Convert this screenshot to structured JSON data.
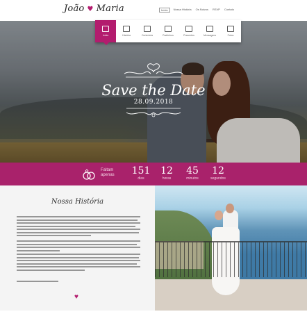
{
  "header": {
    "logo_left": "João",
    "logo_right": "Maria",
    "nav": [
      "Início",
      "Nossa História",
      "Os Noivos",
      "RSVP",
      "Contato"
    ],
    "nav_active": "Início"
  },
  "icon_menu": {
    "items": [
      {
        "label": "Início",
        "icon": "home-icon"
      },
      {
        "label": "História",
        "icon": "book-icon"
      },
      {
        "label": "Cerimônia",
        "icon": "calendar-icon"
      },
      {
        "label": "Padrinhos",
        "icon": "people-icon"
      },
      {
        "label": "Presentes",
        "icon": "gift-icon"
      },
      {
        "label": "Mensagens",
        "icon": "message-icon"
      },
      {
        "label": "Fotos",
        "icon": "camera-icon"
      }
    ],
    "accent": "#b31c6e"
  },
  "hero": {
    "title": "Save the Date",
    "date": "28.09.2018"
  },
  "countdown": {
    "label_line1": "Faltam",
    "label_line2": "apenas",
    "units": [
      {
        "value": "151",
        "label": "dias"
      },
      {
        "value": "12",
        "label": "horas"
      },
      {
        "value": "45",
        "label": "minutos"
      },
      {
        "value": "12",
        "label": "segundos"
      }
    ],
    "bar_color": "#a9226b"
  },
  "story": {
    "title": "Nossa História"
  }
}
